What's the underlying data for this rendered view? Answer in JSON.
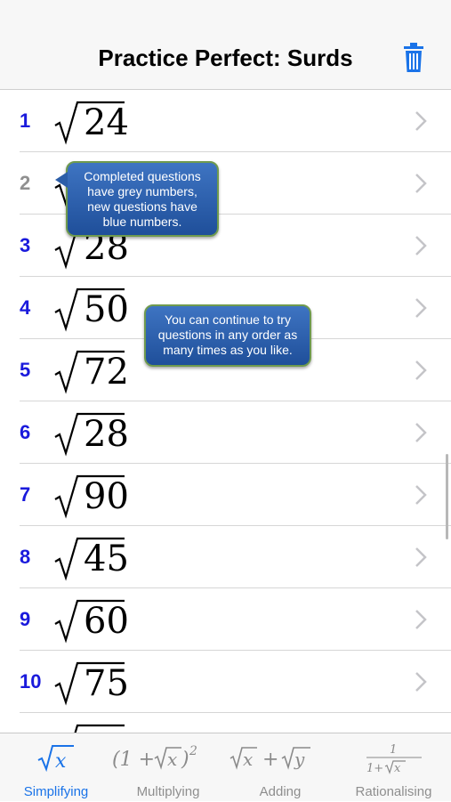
{
  "nav": {
    "title": "Practice Perfect: Surds",
    "trash_icon": "trash-icon"
  },
  "questions": [
    {
      "number": "1",
      "radicand": "24",
      "state": "new"
    },
    {
      "number": "2",
      "radicand": "",
      "state": "done"
    },
    {
      "number": "3",
      "radicand": "28",
      "state": "new"
    },
    {
      "number": "4",
      "radicand": "50",
      "state": "new"
    },
    {
      "number": "5",
      "radicand": "72",
      "state": "new"
    },
    {
      "number": "6",
      "radicand": "28",
      "state": "new"
    },
    {
      "number": "7",
      "radicand": "90",
      "state": "new"
    },
    {
      "number": "8",
      "radicand": "45",
      "state": "new"
    },
    {
      "number": "9",
      "radicand": "60",
      "state": "new"
    },
    {
      "number": "10",
      "radicand": "75",
      "state": "new"
    }
  ],
  "tips": {
    "tip1": "Completed questions have grey numbers, new questions have blue numbers.",
    "tip2": "You can continue to try questions in any order as many times as you like."
  },
  "tabs": [
    {
      "label": "Simplifying",
      "icon": "√x",
      "active": true
    },
    {
      "label": "Multiplying",
      "icon": "(1 + √x)²",
      "active": false
    },
    {
      "label": "Adding",
      "icon": "√x + √y",
      "active": false
    },
    {
      "label": "Rationalising",
      "icon": "1 / (1+√x)",
      "active": false
    }
  ],
  "colors": {
    "new_number": "#1a1adc",
    "done_number": "#909090",
    "accent": "#1a73e8"
  }
}
